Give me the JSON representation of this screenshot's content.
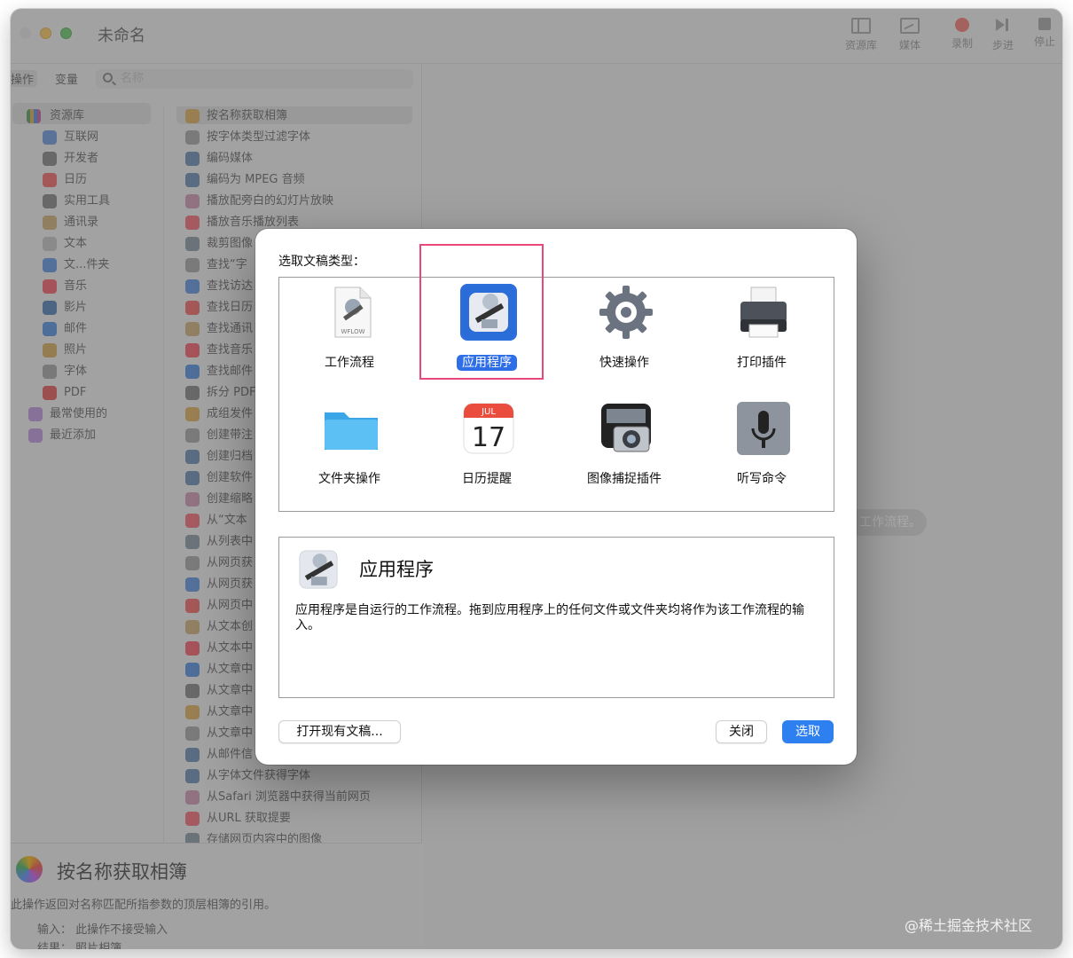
{
  "window": {
    "title": "未命名",
    "toolbar": [
      "资源库",
      "媒体",
      "录制",
      "步进",
      "停止"
    ],
    "tabs": [
      "操作",
      "变量"
    ],
    "search_placeholder": "名称"
  },
  "library": {
    "root": "资源库",
    "items": [
      "互联网",
      "开发者",
      "日历",
      "实用工具",
      "通讯录",
      "文本",
      "文...件夹",
      "音乐",
      "影片",
      "邮件",
      "照片",
      "字体",
      "PDF"
    ],
    "smart": [
      "最常使用的",
      "最近添加"
    ]
  },
  "actions": [
    "按名称获取相簿",
    "按字体类型过滤字体",
    "编码媒体",
    "编码为 MPEG 音频",
    "播放配旁白的幻灯片放映",
    "播放音乐播放列表",
    "裁剪图像",
    "查找“字",
    "查找访达",
    "查找日历",
    "查找通讯",
    "查找音乐",
    "查找邮件",
    "拆分 PDF",
    "成组发件",
    "创建带注",
    "创建归档",
    "创建软件",
    "创建缩略",
    "从“文本",
    "从列表中",
    "从网页获",
    "从网页获",
    "从网页中",
    "从文本创",
    "从文本中",
    "从文章中",
    "从文章中",
    "从文章中",
    "从文章中",
    "从邮件信",
    "从字体文件获得字体",
    "从Safari 浏览器中获得当前网页",
    "从URL 获取提要",
    "存储网页内容中的图像"
  ],
  "action_desc": {
    "title": "按名称获取相簿",
    "text": "此操作返回对名称匹配所指参数的顶层相簿的引用。",
    "input": "输入：  此操作不接受输入",
    "result": "结果：  照片相簿"
  },
  "hint": "工作流程。",
  "watermark": "@稀土掘金技术社区",
  "dialog": {
    "prompt": "选取文稿类型：",
    "types": [
      {
        "label": "工作流程",
        "icon": "wflow-file-icon",
        "icon_text": "WFLOW"
      },
      {
        "label": "应用程序",
        "icon": "automator-app-icon"
      },
      {
        "label": "快速操作",
        "icon": "gear-icon"
      },
      {
        "label": "打印插件",
        "icon": "printer-icon"
      },
      {
        "label": "文件夹操作",
        "icon": "folder-icon"
      },
      {
        "label": "日历提醒",
        "icon": "calendar-icon",
        "month": "JUL",
        "day": "17"
      },
      {
        "label": "图像捕捉插件",
        "icon": "camera-icon"
      },
      {
        "label": "听写命令",
        "icon": "microphone-icon"
      }
    ],
    "selected": 1,
    "info_title": "应用程序",
    "info_text": "应用程序是自运行的工作流程。拖到应用程序上的任何文件或文件夹均将作为该工作流程的输入。",
    "buttons": {
      "open": "打开现有文稿...",
      "close": "关闭",
      "choose": "选取"
    }
  }
}
